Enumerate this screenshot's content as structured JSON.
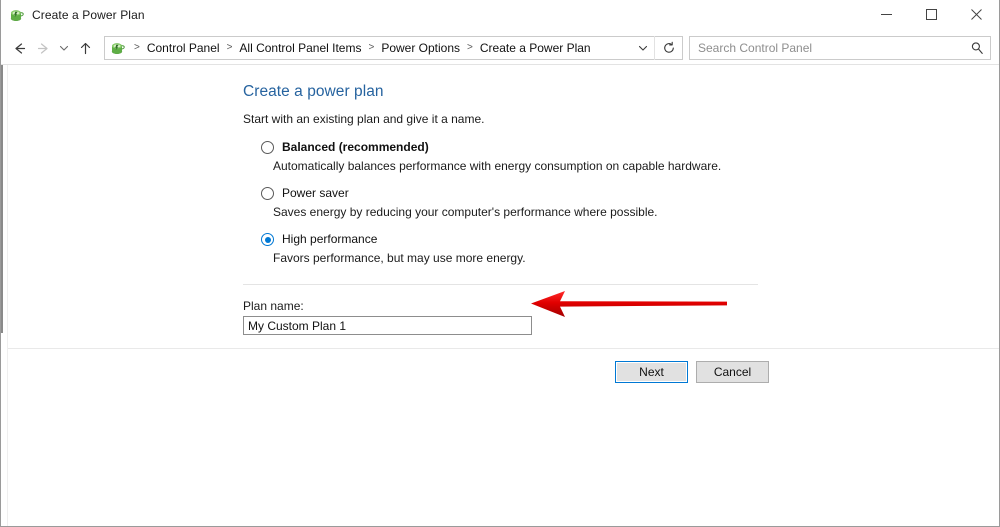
{
  "window": {
    "title": "Create a Power Plan",
    "icon": "power-plan-icon",
    "controls": {
      "minimize": "Minimize",
      "maximize": "Maximize",
      "close": "Close"
    }
  },
  "navbar": {
    "back": "Back",
    "forward": "Forward",
    "recent": "Recent locations",
    "up": "Up one level",
    "address_icon": "power-plan-icon",
    "breadcrumbs": [
      "Control Panel",
      "All Control Panel Items",
      "Power Options",
      "Create a Power Plan"
    ],
    "separator": ">",
    "dropdown": "Previous locations",
    "refresh": "Refresh"
  },
  "search": {
    "placeholder": "Search Control Panel",
    "value": "",
    "icon": "search-icon"
  },
  "page": {
    "title": "Create a power plan",
    "subtitle": "Start with an existing plan and give it a name.",
    "options": [
      {
        "label": "Balanced (recommended)",
        "description": "Automatically balances performance with energy consumption on capable hardware.",
        "selected": false,
        "bold": true
      },
      {
        "label": "Power saver",
        "description": "Saves energy by reducing your computer's performance where possible.",
        "selected": false,
        "bold": false
      },
      {
        "label": "High performance",
        "description": "Favors performance, but may use more energy.",
        "selected": true,
        "bold": false
      }
    ],
    "plan_name_label": "Plan name:",
    "plan_name_value": "My Custom Plan 1"
  },
  "footer": {
    "next_label": "Next",
    "cancel_label": "Cancel"
  },
  "annotation": {
    "type": "arrow-left",
    "color": "#e10000",
    "points_to": "High performance"
  }
}
